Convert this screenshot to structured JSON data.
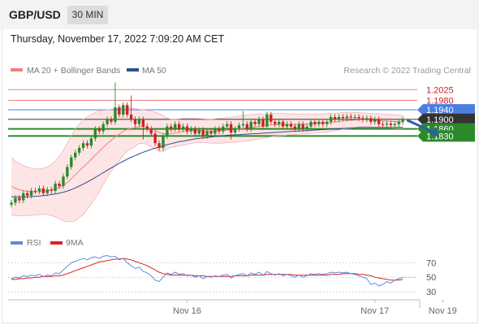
{
  "header": {
    "symbol": "GBP/USD",
    "timeframe": "30 MIN",
    "datetime": "Thursday, November 17, 2022 7:09:20 AM CET"
  },
  "colors": {
    "ma20": "#f08080",
    "ma50": "#2b4f8c",
    "band_fill": "#fde0e0",
    "resistance": "#f08080",
    "pivot": "#4a7fe0",
    "support": "#2a8a2a",
    "current": "#333333",
    "arrow": "#2a5fa8",
    "candle_up": "#2a8a2a",
    "candle_down": "#cc2222",
    "rsi": "#5b8de0",
    "rsi_ma": "#dd2222"
  },
  "chart_data": [
    {
      "type": "candlestick",
      "legend": [
        {
          "name": "MA 20 + Bollinger Bands",
          "color": "#f08080"
        },
        {
          "name": "MA 50",
          "color": "#2b4f8c"
        }
      ],
      "watermark": "Research © 2022 Trading Central",
      "ylim": [
        1.148,
        1.206
      ],
      "x_ticks": [
        {
          "label": "Nov 16",
          "index": 44
        },
        {
          "label": "Nov 17",
          "index": 91
        },
        {
          "label": "Nov 19",
          "index": 108
        }
      ],
      "levels": [
        {
          "label": "1.2025",
          "value": 1.2025,
          "kind": "resistance",
          "color": "#f08080",
          "style": "text"
        },
        {
          "label": "1.1980",
          "value": 1.198,
          "kind": "resistance",
          "color": "#f08080",
          "style": "text"
        },
        {
          "label": "1.1940",
          "value": 1.194,
          "kind": "pivot",
          "color": "#4a7fe0",
          "style": "tag"
        },
        {
          "label": "1.1900",
          "value": 1.19,
          "kind": "current",
          "color": "#333333",
          "style": "tag"
        },
        {
          "label": "1.1860",
          "value": 1.186,
          "kind": "support",
          "color": "#2a8a2a",
          "style": "tag"
        },
        {
          "label": "1.1830",
          "value": 1.183,
          "kind": "support",
          "color": "#2a8a2a",
          "style": "tag"
        }
      ],
      "forecast_arrow": {
        "from_value": 1.1897,
        "to_value": 1.1826,
        "from_offset_bars": 1,
        "to_offset_bars": 9
      },
      "close": [
        1.155,
        1.157,
        1.156,
        1.159,
        1.158,
        1.16,
        1.1598,
        1.161,
        1.159,
        1.1605,
        1.16,
        1.163,
        1.162,
        1.166,
        1.17,
        1.174,
        1.176,
        1.178,
        1.18,
        1.179,
        1.182,
        1.186,
        1.185,
        1.188,
        1.19,
        1.189,
        1.195,
        1.192,
        1.196,
        1.192,
        1.19,
        1.188,
        1.19,
        1.187,
        1.186,
        1.184,
        1.18,
        1.178,
        1.183,
        1.187,
        1.186,
        1.188,
        1.186,
        1.187,
        1.185,
        1.186,
        1.184,
        1.1855,
        1.183,
        1.185,
        1.184,
        1.186,
        1.185,
        1.187,
        1.188,
        1.1845,
        1.186,
        1.1875,
        1.188,
        1.186,
        1.189,
        1.188,
        1.19,
        1.187,
        1.192,
        1.189,
        1.188,
        1.189,
        1.187,
        1.188,
        1.187,
        1.186,
        1.188,
        1.186,
        1.187,
        1.189,
        1.188,
        1.189,
        1.188,
        1.189,
        1.191,
        1.19,
        1.191,
        1.1905,
        1.1912,
        1.1908,
        1.191,
        1.1905,
        1.19,
        1.1905,
        1.189,
        1.19,
        1.188,
        1.1878,
        1.1882,
        1.1876,
        1.188,
        1.189,
        1.19
      ],
      "ma20": [
        1.162,
        1.161,
        1.1605,
        1.16,
        1.1598,
        1.1596,
        1.1595,
        1.1596,
        1.1598,
        1.16,
        1.1603,
        1.1608,
        1.1614,
        1.1622,
        1.1635,
        1.165,
        1.1667,
        1.1684,
        1.17,
        1.1716,
        1.1732,
        1.175,
        1.1765,
        1.1782,
        1.1798,
        1.1812,
        1.1826,
        1.1838,
        1.185,
        1.1858,
        1.1862,
        1.1866,
        1.187,
        1.187,
        1.1866,
        1.186,
        1.1853,
        1.1845,
        1.184,
        1.184,
        1.1841,
        1.1843,
        1.1845,
        1.1848,
        1.185,
        1.1852,
        1.1853,
        1.1853,
        1.1852,
        1.1851,
        1.185,
        1.1851,
        1.1852,
        1.1853,
        1.1855,
        1.1856,
        1.1858,
        1.186,
        1.1862,
        1.1864,
        1.1866,
        1.1868,
        1.187,
        1.1872,
        1.1874,
        1.1876,
        1.1877,
        1.1878,
        1.1878,
        1.1879,
        1.1879,
        1.1879,
        1.188,
        1.188,
        1.188,
        1.1881,
        1.1882,
        1.1883,
        1.1884,
        1.1885,
        1.1887,
        1.1889,
        1.1891,
        1.1893,
        1.1895,
        1.1896,
        1.1897,
        1.1898,
        1.1898,
        1.1898,
        1.1897,
        1.1896,
        1.1895,
        1.1894,
        1.1893,
        1.1892,
        1.1891,
        1.189,
        1.189
      ],
      "bb_upper": [
        1.174,
        1.1725,
        1.1715,
        1.1705,
        1.17,
        1.1695,
        1.1692,
        1.1692,
        1.1695,
        1.17,
        1.171,
        1.1725,
        1.1745,
        1.177,
        1.18,
        1.183,
        1.186,
        1.188,
        1.19,
        1.191,
        1.192,
        1.193,
        1.1935,
        1.1938,
        1.194,
        1.1942,
        1.1945,
        1.195,
        1.1952,
        1.195,
        1.1948,
        1.1945,
        1.1942,
        1.194,
        1.1938,
        1.1935,
        1.193,
        1.1925,
        1.1915,
        1.1905,
        1.19,
        1.19,
        1.1902,
        1.1904,
        1.1906,
        1.1905,
        1.1904,
        1.1903,
        1.1902,
        1.1901,
        1.19,
        1.1902,
        1.1904,
        1.1906,
        1.1908,
        1.191,
        1.1912,
        1.1914,
        1.1916,
        1.1918,
        1.192,
        1.1921,
        1.1922,
        1.1923,
        1.1924,
        1.1925,
        1.1925,
        1.1925,
        1.1925,
        1.1924,
        1.1923,
        1.1922,
        1.1922,
        1.1921,
        1.1921,
        1.1921,
        1.1922,
        1.1922,
        1.1923,
        1.1924,
        1.1925,
        1.1926,
        1.1927,
        1.1928,
        1.1929,
        1.193,
        1.1929,
        1.1928,
        1.1927,
        1.1926,
        1.1925,
        1.1924,
        1.1923,
        1.1922,
        1.1921,
        1.192,
        1.1919,
        1.1918,
        1.1918
      ],
      "bb_lower": [
        1.15,
        1.1495,
        1.1495,
        1.1495,
        1.1496,
        1.1497,
        1.1498,
        1.15,
        1.1501,
        1.15,
        1.1496,
        1.1491,
        1.1483,
        1.1474,
        1.147,
        1.147,
        1.1474,
        1.1488,
        1.15,
        1.1522,
        1.1544,
        1.157,
        1.1595,
        1.1626,
        1.1656,
        1.1682,
        1.1707,
        1.1726,
        1.1748,
        1.1766,
        1.1776,
        1.1787,
        1.1798,
        1.18,
        1.1794,
        1.1785,
        1.1776,
        1.1765,
        1.1765,
        1.1775,
        1.1782,
        1.1786,
        1.1788,
        1.1792,
        1.1794,
        1.1799,
        1.1802,
        1.1803,
        1.1802,
        1.1801,
        1.18,
        1.18,
        1.18,
        1.18,
        1.1802,
        1.1802,
        1.1804,
        1.1806,
        1.1808,
        1.181,
        1.1812,
        1.1815,
        1.1818,
        1.1821,
        1.1824,
        1.1827,
        1.1829,
        1.1831,
        1.1831,
        1.1834,
        1.1835,
        1.1836,
        1.1838,
        1.1839,
        1.1839,
        1.1841,
        1.1842,
        1.1844,
        1.1845,
        1.1846,
        1.1849,
        1.1852,
        1.1855,
        1.1858,
        1.1861,
        1.1862,
        1.1865,
        1.1868,
        1.1869,
        1.187,
        1.1869,
        1.1868,
        1.1867,
        1.1866,
        1.1865,
        1.1864,
        1.1863,
        1.1862,
        1.1862
      ],
      "ma50": [
        1.1575,
        1.1574,
        1.1574,
        1.1574,
        1.1575,
        1.1576,
        1.1577,
        1.1578,
        1.158,
        1.1582,
        1.1584,
        1.1587,
        1.159,
        1.1594,
        1.1599,
        1.1605,
        1.1612,
        1.162,
        1.1628,
        1.1637,
        1.1646,
        1.1656,
        1.1666,
        1.1676,
        1.1686,
        1.1696,
        1.1706,
        1.1715,
        1.1724,
        1.1733,
        1.1741,
        1.1748,
        1.1755,
        1.1762,
        1.1768,
        1.1774,
        1.1779,
        1.1784,
        1.1789,
        1.1794,
        1.1798,
        1.1802,
        1.1806,
        1.1809,
        1.1812,
        1.1815,
        1.1818,
        1.182,
        1.1822,
        1.1824,
        1.1826,
        1.1828,
        1.1829,
        1.1831,
        1.1833,
        1.1834,
        1.1835,
        1.1836,
        1.1837,
        1.1838,
        1.1839,
        1.184,
        1.1841,
        1.1842,
        1.1843,
        1.1844,
        1.1845,
        1.1846,
        1.1847,
        1.1848,
        1.1849,
        1.185,
        1.1851,
        1.1852,
        1.1853,
        1.1854,
        1.1855,
        1.1856,
        1.1857,
        1.1858,
        1.1859,
        1.186,
        1.1861,
        1.1862,
        1.1863,
        1.1864,
        1.1865,
        1.1866,
        1.1866,
        1.1866,
        1.1866,
        1.1866,
        1.1866,
        1.1866,
        1.1866,
        1.1866,
        1.1866,
        1.1866,
        1.1866
      ]
    },
    {
      "type": "line",
      "legend": [
        {
          "name": "RSI",
          "color": "#5b8de0"
        },
        {
          "name": "9MA",
          "color": "#dd2222"
        }
      ],
      "ylim": [
        20,
        85
      ],
      "y_ticks": [
        70,
        50,
        30
      ],
      "rsi": [
        48,
        50,
        49,
        52,
        51,
        53,
        52,
        54,
        51,
        53,
        52,
        56,
        55,
        60,
        65,
        70,
        72,
        74,
        76,
        74,
        77,
        78,
        76,
        79,
        80,
        78,
        79,
        74,
        76,
        70,
        66,
        62,
        64,
        58,
        56,
        52,
        46,
        44,
        50,
        56,
        54,
        57,
        54,
        55,
        52,
        53,
        50,
        52,
        48,
        51,
        50,
        52,
        51,
        53,
        54,
        49,
        52,
        54,
        55,
        52,
        56,
        54,
        57,
        53,
        58,
        55,
        53,
        55,
        52,
        54,
        52,
        50,
        53,
        50,
        52,
        55,
        54,
        55,
        54,
        55,
        57,
        56,
        57,
        56,
        57,
        55,
        54,
        52,
        50,
        48,
        40,
        42,
        38,
        40,
        44,
        42,
        46,
        48,
        50
      ],
      "rsi_ma": [
        47,
        47,
        48,
        48,
        49,
        49,
        50,
        50,
        51,
        51,
        51,
        52,
        52,
        53,
        55,
        57,
        59,
        61,
        63,
        65,
        67,
        69,
        71,
        72,
        73,
        74,
        75,
        75,
        76,
        75,
        74,
        72,
        70,
        68,
        66,
        63,
        60,
        57,
        55,
        54,
        53,
        53,
        53,
        53,
        53,
        53,
        52,
        52,
        52,
        51,
        51,
        51,
        51,
        51,
        51,
        51,
        52,
        52,
        52,
        52,
        53,
        53,
        53,
        53,
        54,
        54,
        54,
        54,
        54,
        54,
        54,
        53,
        53,
        53,
        53,
        53,
        53,
        53,
        53,
        53,
        54,
        54,
        54,
        55,
        55,
        55,
        55,
        54,
        54,
        53,
        52,
        50,
        49,
        48,
        47,
        46,
        46,
        46,
        47
      ]
    }
  ]
}
